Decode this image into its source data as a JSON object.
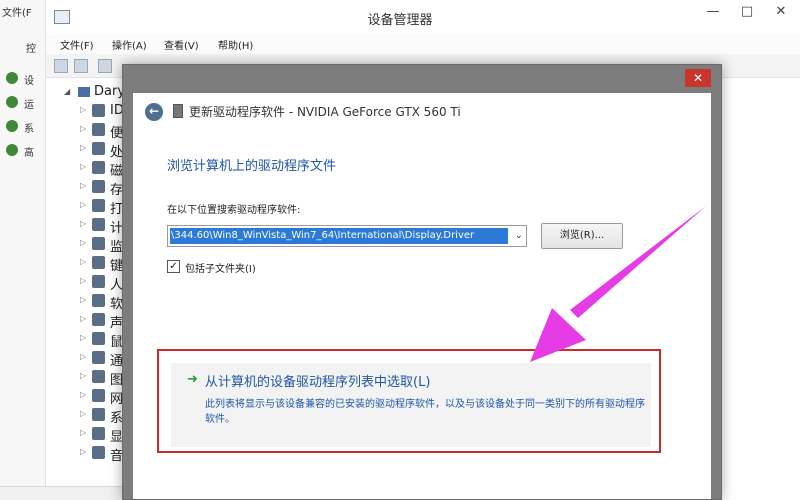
{
  "background_window": {
    "title": "设备管理器",
    "menu": [
      "文件(F)",
      "操作(A)",
      "查看(V)",
      "帮助(H)"
    ],
    "left_fragments": [
      "文件(F",
      "控"
    ],
    "explorer_items": [
      "设",
      "运",
      "系",
      "高"
    ],
    "tree_root": "Dary",
    "tree_items": [
      "ID",
      "便",
      "处",
      "磁",
      "存",
      "打",
      "计",
      "监",
      "键",
      "人",
      "软",
      "声",
      "鼠",
      "通",
      "图",
      "网",
      "系",
      "显",
      "音"
    ]
  },
  "window_controls": {
    "minimize": "—",
    "maximize": "□",
    "close": "✕"
  },
  "dialog": {
    "close_glyph": "✕",
    "back_glyph": "←",
    "title": "更新驱动程序软件 - NVIDIA GeForce GTX 560 Ti",
    "heading": "浏览计算机上的驱动程序文件",
    "path_label": "在以下位置搜索驱动程序软件:",
    "path_value": "\\344.60\\Win8_WinVista_Win7_64\\International\\Display.Driver",
    "path_dropdown_glyph": "⌄",
    "browse_button": "浏览(R)...",
    "include_subfolders_label": "包括子文件夹(I)",
    "include_subfolders_checked": true,
    "check_glyph": "✓",
    "pick_option": {
      "arrow_glyph": "➜",
      "title": "从计算机的设备驱动程序列表中选取(L)",
      "description": "此列表将显示与该设备兼容的已安装的驱动程序软件，以及与该设备处于同一类别下的所有驱动程序软件。"
    }
  },
  "annotation": {
    "color": "#e63ce6",
    "highlight_color": "#cf2a2a"
  }
}
